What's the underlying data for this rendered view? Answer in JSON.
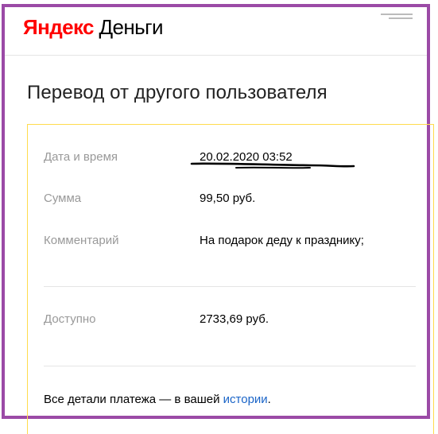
{
  "brand": {
    "logo_part1": "Яндекс",
    "logo_part2": "Деньги"
  },
  "page": {
    "title": "Перевод от другого пользователя"
  },
  "details": {
    "datetime_label": "Дата и время",
    "datetime_value": "20.02.2020 03:52",
    "amount_label": "Сумма",
    "amount_value": "99,50 руб.",
    "comment_label": "Комментарий",
    "comment_value": "На подарок деду к празднику;",
    "available_label": "Доступно",
    "available_value": "2733,69 руб."
  },
  "footer": {
    "text_before": "Все детали платежа — в вашей ",
    "link_label": "истории",
    "text_after": "."
  },
  "colors": {
    "frame": "#9b4aa6",
    "card_border": "#ffdb4d",
    "link": "#1a64c7",
    "label": "#999999"
  }
}
